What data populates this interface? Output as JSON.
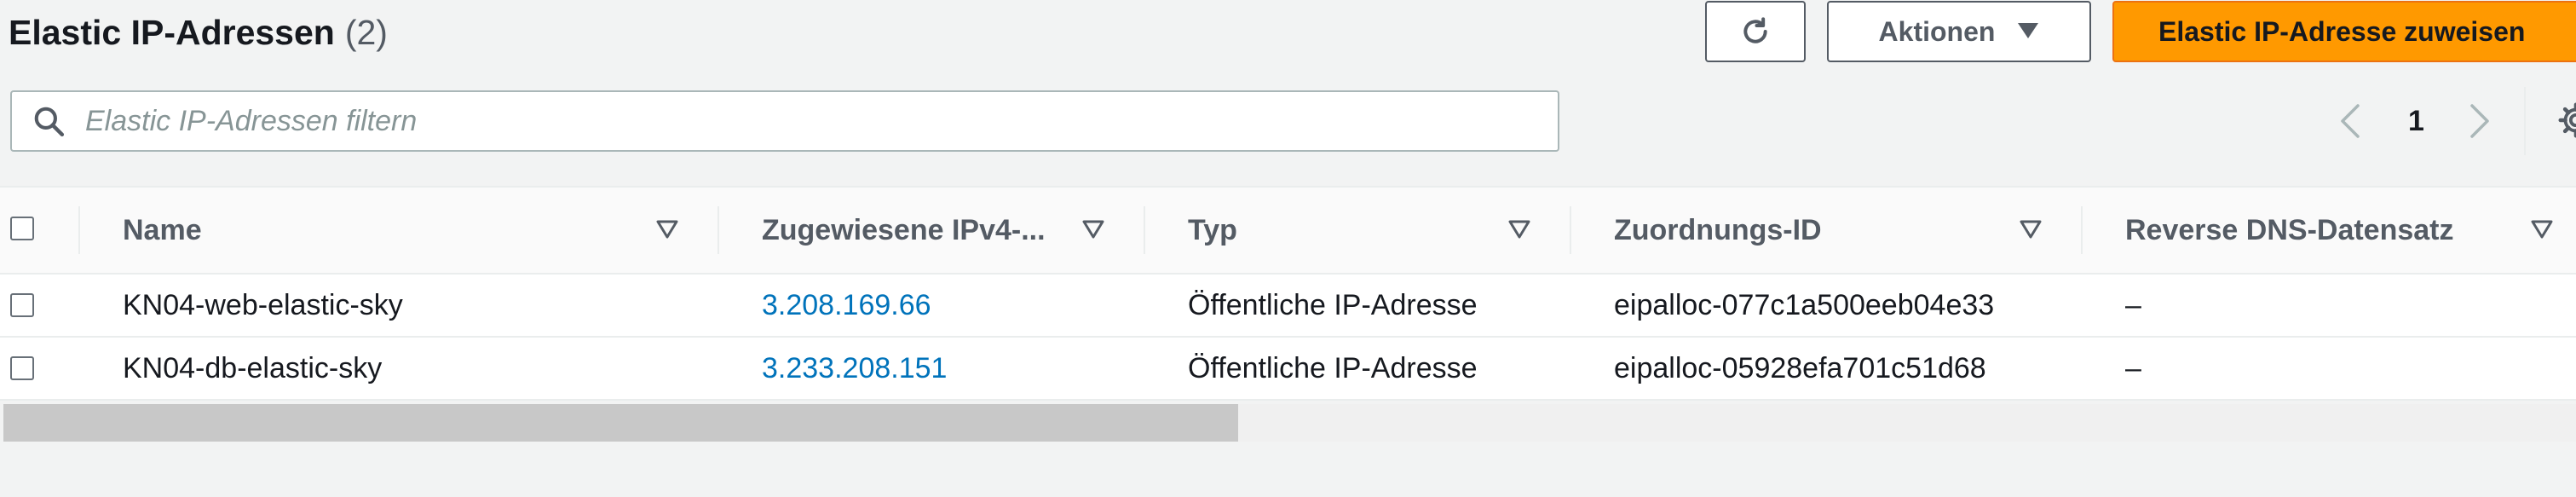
{
  "header": {
    "title": "Elastic IP-Adressen",
    "count": "(2)",
    "actions_label": "Aktionen",
    "allocate_label": "Elastic IP-Adresse zuweisen"
  },
  "icons": {
    "refresh": "refresh-icon",
    "actions_caret": "caret-down-icon",
    "search": "search-icon",
    "prev": "chevron-left-icon",
    "next": "chevron-right-icon",
    "settings": "gear-icon",
    "sort": "sort-caret-icon"
  },
  "filter": {
    "placeholder": "Elastic IP-Adressen filtern",
    "value": ""
  },
  "pagination": {
    "current_page": "1"
  },
  "table": {
    "columns": [
      "Name",
      "Zugewiesene IPv4-...",
      "Typ",
      "Zuordnungs-ID",
      "Reverse DNS-Datensatz"
    ],
    "rows": [
      {
        "name": "KN04-web-elastic-sky",
        "ip": "3.208.169.66",
        "type": "Öffentliche IP-Adresse",
        "allocation_id": "eipalloc-077c1a500eeb04e33",
        "reverse_dns": "–"
      },
      {
        "name": "KN04-db-elastic-sky",
        "ip": "3.233.208.151",
        "type": "Öffentliche IP-Adresse",
        "allocation_id": "eipalloc-05928efa701c51d68",
        "reverse_dns": "–"
      }
    ]
  },
  "scrollbar": {
    "thumb_fraction": 0.48
  },
  "colors": {
    "primary_button": "#ff9900",
    "link": "#0073bb",
    "text": "#16191f",
    "muted_text": "#545b64",
    "background": "#f2f3f3"
  }
}
